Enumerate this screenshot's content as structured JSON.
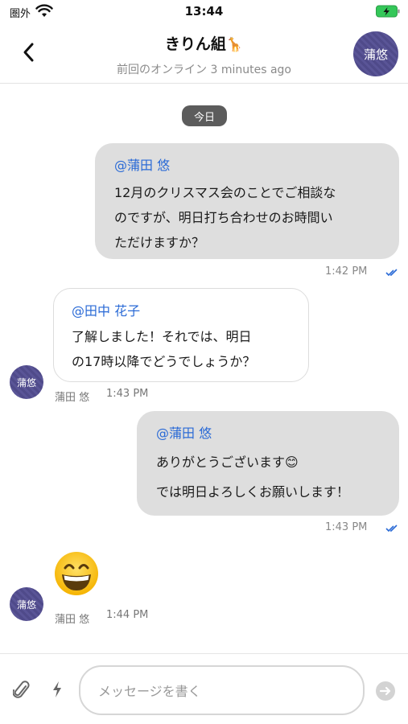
{
  "status_bar": {
    "carrier": "圏外",
    "time": "13:44"
  },
  "header": {
    "back_icon": "chevron-left-icon",
    "title": "きりん組",
    "title_emoji": "🦒",
    "subtitle": "前回のオンライン 3 minutes ago",
    "avatar_text": "蒲悠"
  },
  "date_divider": "今日",
  "messages": [
    {
      "direction": "outgoing",
      "mention": "@蒲田 悠",
      "lines": [
        "12月のクリスマス会のことでご相談な",
        "のですが、明日打ち合わせのお時間い",
        "ただけますか？"
      ],
      "time": "1:42 PM",
      "read_receipt": "double-check-icon"
    },
    {
      "direction": "incoming",
      "mention": "@田中 花子",
      "lines": [
        "了解しました！それでは、明日",
        "の17時以降でどうでしょうか？"
      ],
      "sender": "蒲田 悠",
      "avatar_text": "蒲悠",
      "time": "1:43 PM"
    },
    {
      "direction": "outgoing",
      "mention": "@蒲田 悠",
      "lines": [
        "ありがとうございます😊",
        "では明日よろしくお願いします！"
      ],
      "time": "1:43 PM",
      "read_receipt": "double-check-icon"
    },
    {
      "direction": "incoming",
      "emoji": "grinning-face-emoji",
      "sender": "蒲田 悠",
      "avatar_text": "蒲悠",
      "time": "1:44 PM"
    }
  ],
  "composer": {
    "attach_icon": "paperclip-icon",
    "quick_icon": "lightning-icon",
    "placeholder": "メッセージを書く",
    "send_icon": "send-arrow-icon"
  },
  "colors": {
    "accent": "#2a6ad6",
    "outgoing_bubble": "#dedede",
    "avatar": "#524d8e",
    "battery": "#34c759"
  }
}
